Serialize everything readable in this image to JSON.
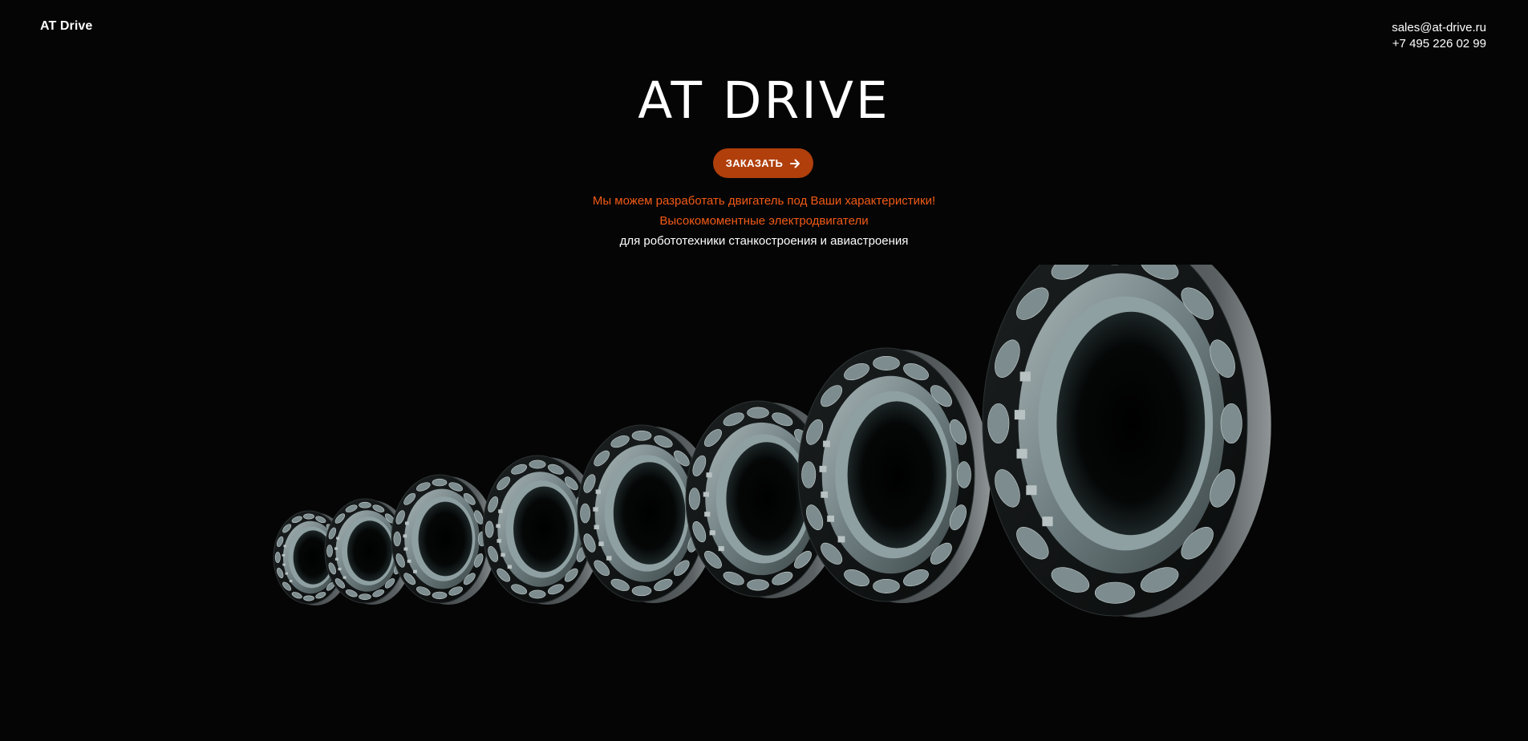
{
  "header": {
    "logo_text": "AT Drive",
    "email": "sales@at-drive.ru",
    "phone": "+7 495 226 02 99"
  },
  "hero": {
    "title": "AT DRIVE",
    "order_button_label": "ЗАКАЗАТЬ",
    "order_button_icon": "arrow-right-icon",
    "tagline_1": "Мы можем разработать двигатель под Ваши характеристики!",
    "tagline_2": "Высокомоментные электродвигатели",
    "tagline_3": "для робототехники станкостроения и авиастроения"
  },
  "colors": {
    "background": "#050505",
    "accent": "#f25a16",
    "button": "#b03f0c",
    "text": "#ffffff"
  }
}
